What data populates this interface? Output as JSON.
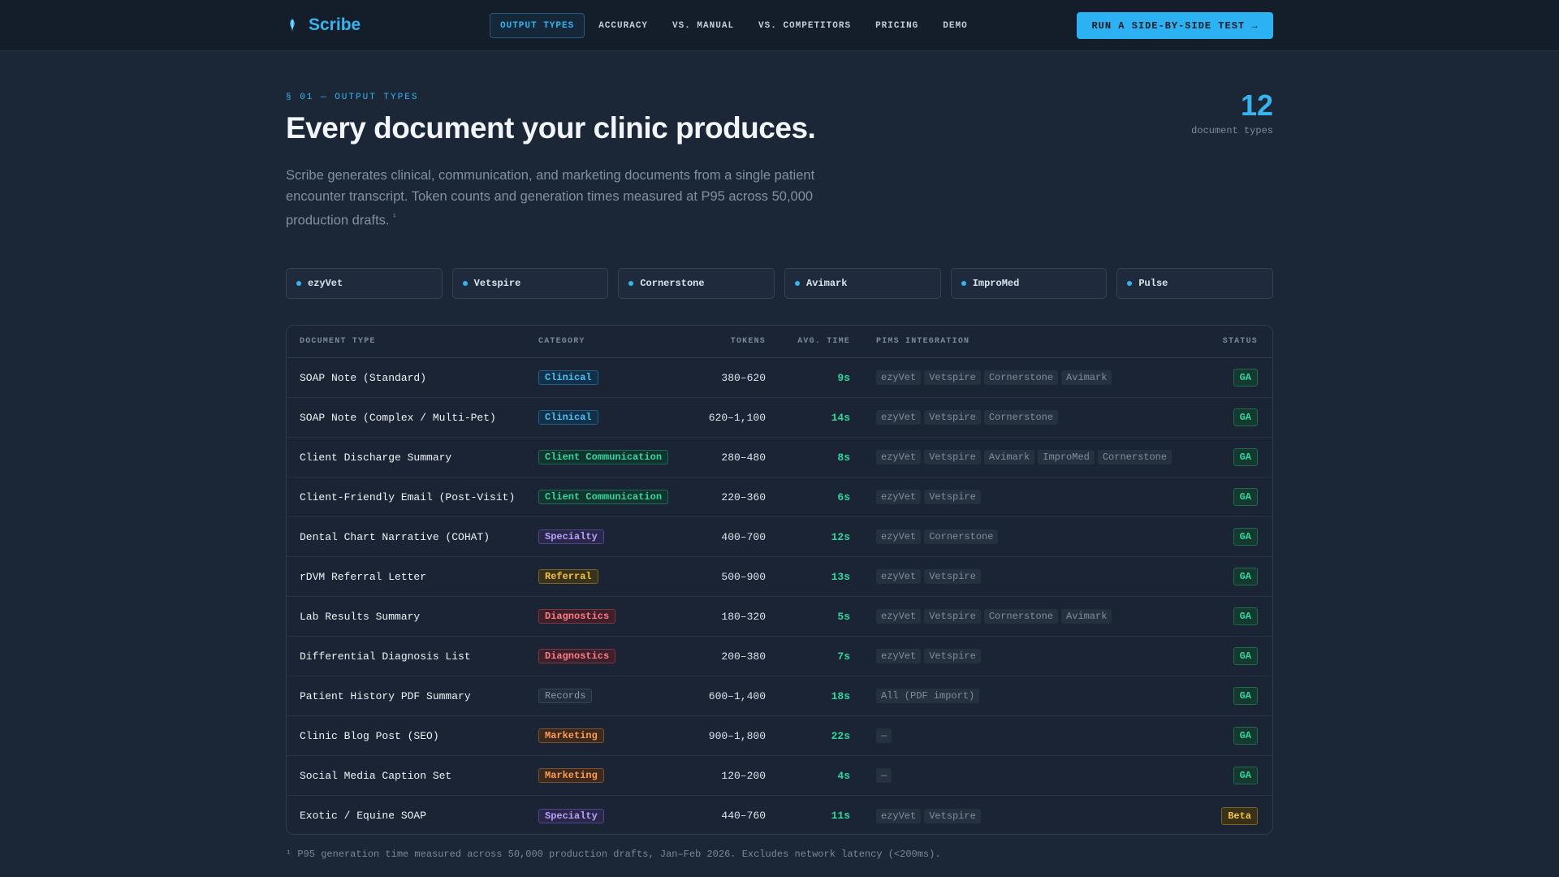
{
  "nav": {
    "brand": "Scribe",
    "links": [
      "OUTPUT TYPES",
      "ACCURACY",
      "VS. MANUAL",
      "VS. COMPETITORS",
      "PRICING",
      "DEMO"
    ],
    "cta": "RUN A SIDE-BY-SIDE TEST →"
  },
  "hero": {
    "eyebrow": "§ 01 — OUTPUT TYPES",
    "title": "Every document your clinic produces.",
    "lead": "Scribe generates clinical, communication, and marketing documents from a single patient encounter transcript. Token counts and generation times measured at P95 across 50,000 production drafts.",
    "lead_sup": "¹",
    "stat_value": "12",
    "stat_label": "document types"
  },
  "pims": [
    "ezyVet",
    "Vetspire",
    "Cornerstone",
    "Avimark",
    "ImproMed",
    "Pulse"
  ],
  "table": {
    "headers": {
      "doc": "DOCUMENT TYPE",
      "category": "CATEGORY",
      "tokens": "TOKENS",
      "time": "AVG. TIME",
      "pims": "PIMS INTEGRATION",
      "status": "STATUS"
    },
    "rows": [
      {
        "doc": "SOAP Note (Standard)",
        "category": "Clinical",
        "cat_class": "b-clinical",
        "tokens": "380–620",
        "time": "9s",
        "pims": [
          "ezyVet",
          "Vetspire",
          "Cornerstone",
          "Avimark"
        ],
        "status": "GA"
      },
      {
        "doc": "SOAP Note (Complex / Multi-Pet)",
        "category": "Clinical",
        "cat_class": "b-clinical",
        "tokens": "620–1,100",
        "time": "14s",
        "pims": [
          "ezyVet",
          "Vetspire",
          "Cornerstone"
        ],
        "status": "GA"
      },
      {
        "doc": "Client Discharge Summary",
        "category": "Client Communication",
        "cat_class": "b-comm",
        "tokens": "280–480",
        "time": "8s",
        "pims": [
          "ezyVet",
          "Vetspire",
          "Avimark",
          "ImproMed",
          "Cornerstone"
        ],
        "status": "GA"
      },
      {
        "doc": "Client-Friendly Email (Post-Visit)",
        "category": "Client Communication",
        "cat_class": "b-comm",
        "tokens": "220–360",
        "time": "6s",
        "pims": [
          "ezyVet",
          "Vetspire"
        ],
        "status": "GA"
      },
      {
        "doc": "Dental Chart Narrative (COHAT)",
        "category": "Specialty",
        "cat_class": "b-specialty",
        "tokens": "400–700",
        "time": "12s",
        "pims": [
          "ezyVet",
          "Cornerstone"
        ],
        "status": "GA"
      },
      {
        "doc": "rDVM Referral Letter",
        "category": "Referral",
        "cat_class": "b-referral",
        "tokens": "500–900",
        "time": "13s",
        "pims": [
          "ezyVet",
          "Vetspire"
        ],
        "status": "GA"
      },
      {
        "doc": "Lab Results Summary",
        "category": "Diagnostics",
        "cat_class": "b-diag",
        "tokens": "180–320",
        "time": "5s",
        "pims": [
          "ezyVet",
          "Vetspire",
          "Cornerstone",
          "Avimark"
        ],
        "status": "GA"
      },
      {
        "doc": "Differential Diagnosis List",
        "category": "Diagnostics",
        "cat_class": "b-diag",
        "tokens": "200–380",
        "time": "7s",
        "pims": [
          "ezyVet",
          "Vetspire"
        ],
        "status": "GA"
      },
      {
        "doc": "Patient History PDF Summary",
        "category": "Records",
        "cat_class": "b-records",
        "tokens": "600–1,400",
        "time": "18s",
        "pims": [
          "All (PDF import)"
        ],
        "status": "GA"
      },
      {
        "doc": "Clinic Blog Post (SEO)",
        "category": "Marketing",
        "cat_class": "b-marketing",
        "tokens": "900–1,800",
        "time": "22s",
        "pims": [
          "—"
        ],
        "status": "GA"
      },
      {
        "doc": "Social Media Caption Set",
        "category": "Marketing",
        "cat_class": "b-marketing",
        "tokens": "120–200",
        "time": "4s",
        "pims": [
          "—"
        ],
        "status": "GA"
      },
      {
        "doc": "Exotic / Equine SOAP",
        "category": "Specialty",
        "cat_class": "b-specialty",
        "tokens": "440–760",
        "time": "11s",
        "pims": [
          "ezyVet",
          "Vetspire"
        ],
        "status": "Beta"
      }
    ]
  },
  "footnote": "¹ P95 generation time measured across 50,000 production drafts, Jan–Feb 2026. Excludes network latency (<200ms).",
  "colors": {
    "accent": "#35b4f0",
    "time_green": "#2fd69d",
    "background": "#1b2636"
  }
}
